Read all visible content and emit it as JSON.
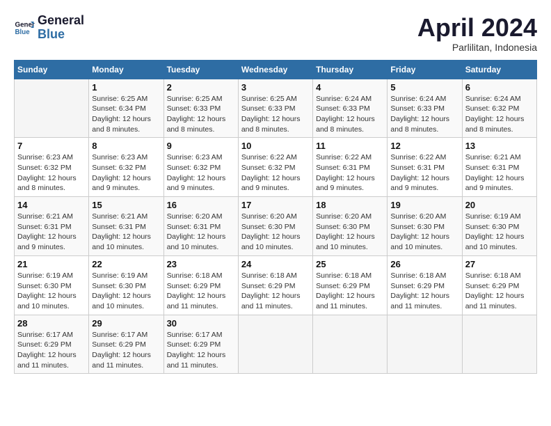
{
  "header": {
    "logo_line1": "General",
    "logo_line2": "Blue",
    "month_title": "April 2024",
    "location": "Parlilitan, Indonesia"
  },
  "calendar": {
    "weekdays": [
      "Sunday",
      "Monday",
      "Tuesday",
      "Wednesday",
      "Thursday",
      "Friday",
      "Saturday"
    ],
    "weeks": [
      [
        {
          "day": "",
          "info": ""
        },
        {
          "day": "1",
          "info": "Sunrise: 6:25 AM\nSunset: 6:34 PM\nDaylight: 12 hours and 8 minutes."
        },
        {
          "day": "2",
          "info": "Sunrise: 6:25 AM\nSunset: 6:33 PM\nDaylight: 12 hours and 8 minutes."
        },
        {
          "day": "3",
          "info": "Sunrise: 6:25 AM\nSunset: 6:33 PM\nDaylight: 12 hours and 8 minutes."
        },
        {
          "day": "4",
          "info": "Sunrise: 6:24 AM\nSunset: 6:33 PM\nDaylight: 12 hours and 8 minutes."
        },
        {
          "day": "5",
          "info": "Sunrise: 6:24 AM\nSunset: 6:33 PM\nDaylight: 12 hours and 8 minutes."
        },
        {
          "day": "6",
          "info": "Sunrise: 6:24 AM\nSunset: 6:32 PM\nDaylight: 12 hours and 8 minutes."
        }
      ],
      [
        {
          "day": "7",
          "info": "Sunrise: 6:23 AM\nSunset: 6:32 PM\nDaylight: 12 hours and 8 minutes."
        },
        {
          "day": "8",
          "info": "Sunrise: 6:23 AM\nSunset: 6:32 PM\nDaylight: 12 hours and 9 minutes."
        },
        {
          "day": "9",
          "info": "Sunrise: 6:23 AM\nSunset: 6:32 PM\nDaylight: 12 hours and 9 minutes."
        },
        {
          "day": "10",
          "info": "Sunrise: 6:22 AM\nSunset: 6:32 PM\nDaylight: 12 hours and 9 minutes."
        },
        {
          "day": "11",
          "info": "Sunrise: 6:22 AM\nSunset: 6:31 PM\nDaylight: 12 hours and 9 minutes."
        },
        {
          "day": "12",
          "info": "Sunrise: 6:22 AM\nSunset: 6:31 PM\nDaylight: 12 hours and 9 minutes."
        },
        {
          "day": "13",
          "info": "Sunrise: 6:21 AM\nSunset: 6:31 PM\nDaylight: 12 hours and 9 minutes."
        }
      ],
      [
        {
          "day": "14",
          "info": "Sunrise: 6:21 AM\nSunset: 6:31 PM\nDaylight: 12 hours and 9 minutes."
        },
        {
          "day": "15",
          "info": "Sunrise: 6:21 AM\nSunset: 6:31 PM\nDaylight: 12 hours and 10 minutes."
        },
        {
          "day": "16",
          "info": "Sunrise: 6:20 AM\nSunset: 6:31 PM\nDaylight: 12 hours and 10 minutes."
        },
        {
          "day": "17",
          "info": "Sunrise: 6:20 AM\nSunset: 6:30 PM\nDaylight: 12 hours and 10 minutes."
        },
        {
          "day": "18",
          "info": "Sunrise: 6:20 AM\nSunset: 6:30 PM\nDaylight: 12 hours and 10 minutes."
        },
        {
          "day": "19",
          "info": "Sunrise: 6:20 AM\nSunset: 6:30 PM\nDaylight: 12 hours and 10 minutes."
        },
        {
          "day": "20",
          "info": "Sunrise: 6:19 AM\nSunset: 6:30 PM\nDaylight: 12 hours and 10 minutes."
        }
      ],
      [
        {
          "day": "21",
          "info": "Sunrise: 6:19 AM\nSunset: 6:30 PM\nDaylight: 12 hours and 10 minutes."
        },
        {
          "day": "22",
          "info": "Sunrise: 6:19 AM\nSunset: 6:30 PM\nDaylight: 12 hours and 10 minutes."
        },
        {
          "day": "23",
          "info": "Sunrise: 6:18 AM\nSunset: 6:29 PM\nDaylight: 12 hours and 11 minutes."
        },
        {
          "day": "24",
          "info": "Sunrise: 6:18 AM\nSunset: 6:29 PM\nDaylight: 12 hours and 11 minutes."
        },
        {
          "day": "25",
          "info": "Sunrise: 6:18 AM\nSunset: 6:29 PM\nDaylight: 12 hours and 11 minutes."
        },
        {
          "day": "26",
          "info": "Sunrise: 6:18 AM\nSunset: 6:29 PM\nDaylight: 12 hours and 11 minutes."
        },
        {
          "day": "27",
          "info": "Sunrise: 6:18 AM\nSunset: 6:29 PM\nDaylight: 12 hours and 11 minutes."
        }
      ],
      [
        {
          "day": "28",
          "info": "Sunrise: 6:17 AM\nSunset: 6:29 PM\nDaylight: 12 hours and 11 minutes."
        },
        {
          "day": "29",
          "info": "Sunrise: 6:17 AM\nSunset: 6:29 PM\nDaylight: 12 hours and 11 minutes."
        },
        {
          "day": "30",
          "info": "Sunrise: 6:17 AM\nSunset: 6:29 PM\nDaylight: 12 hours and 11 minutes."
        },
        {
          "day": "",
          "info": ""
        },
        {
          "day": "",
          "info": ""
        },
        {
          "day": "",
          "info": ""
        },
        {
          "day": "",
          "info": ""
        }
      ]
    ]
  }
}
